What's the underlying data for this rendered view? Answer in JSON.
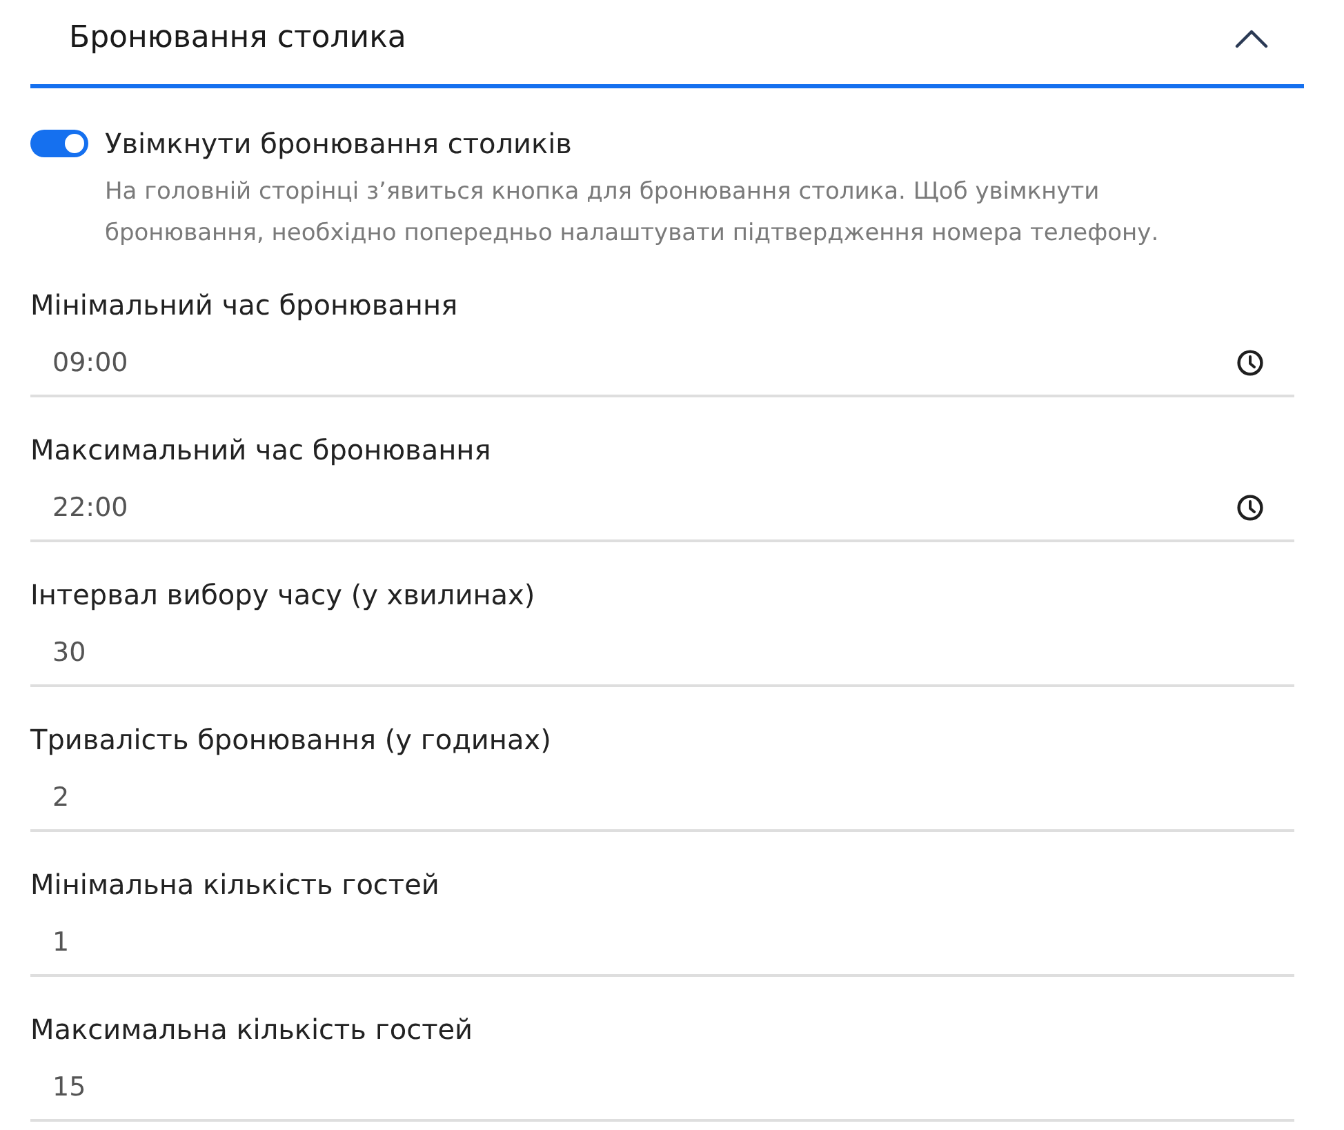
{
  "section": {
    "title": "Бронювання столика",
    "expanded": true
  },
  "toggle": {
    "label": "Увімкнути бронювання столиків",
    "on": true,
    "description": "На головній сторінці з’явиться кнопка для бронювання столика. Щоб увімкнути бронювання, необхідно попередньо налаштувати підтвердження номера телефону."
  },
  "fields": [
    {
      "kind": "time",
      "label": "Мінімальний час бронювання",
      "value": "09:00"
    },
    {
      "kind": "time",
      "label": "Максимальний час бронювання",
      "value": "22:00"
    },
    {
      "kind": "number",
      "label": "Інтервал вибору часу (у хвилинах)",
      "value": "30"
    },
    {
      "kind": "number",
      "label": "Тривалість бронювання (у годинах)",
      "value": "2"
    },
    {
      "kind": "number",
      "label": "Мінімальна кількість гостей",
      "value": "1"
    },
    {
      "kind": "number",
      "label": "Максимальна кількість гостей",
      "value": "15"
    }
  ]
}
